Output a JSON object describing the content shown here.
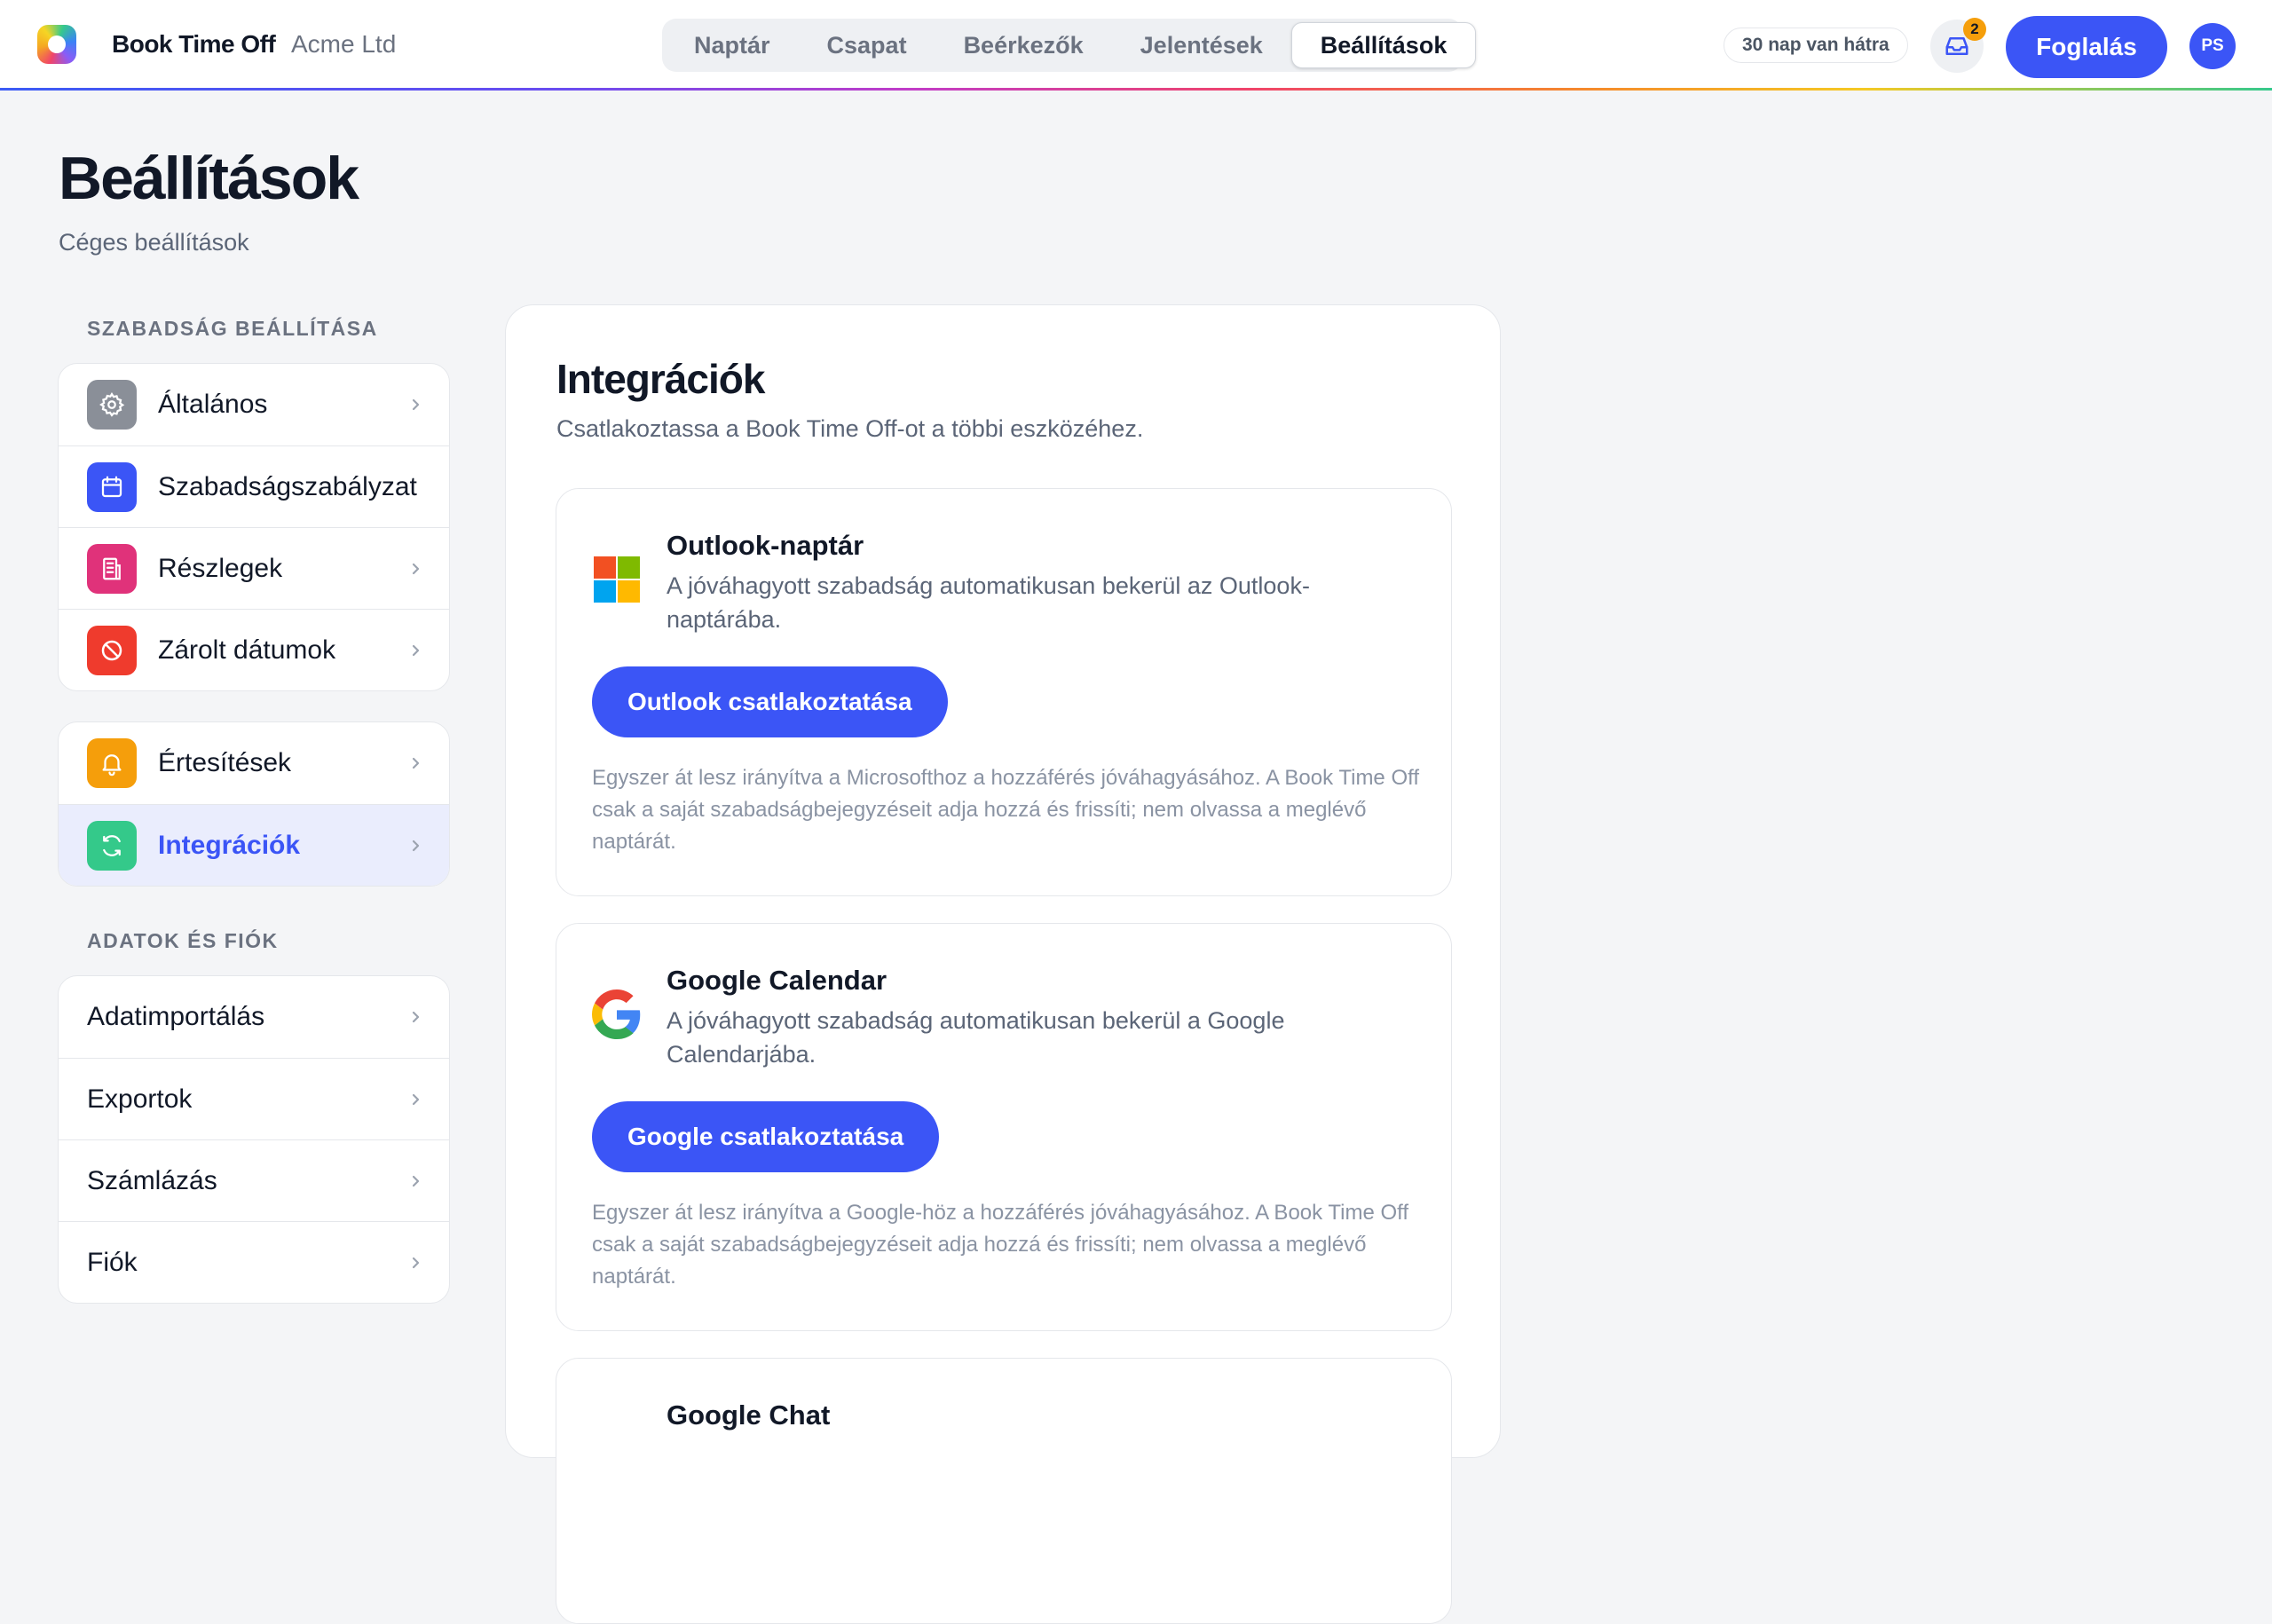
{
  "app": {
    "brand": "Book Time Off",
    "org": "Acme Ltd"
  },
  "nav": {
    "tabs": [
      {
        "label": "Naptár"
      },
      {
        "label": "Csapat"
      },
      {
        "label": "Beérkezők"
      },
      {
        "label": "Jelentések"
      },
      {
        "label": "Beállítások",
        "active": true
      }
    ]
  },
  "header": {
    "days_left": "30 nap van hátra",
    "inbox_count": "2",
    "book_label": "Foglalás",
    "avatar_initials": "PS"
  },
  "page": {
    "title": "Beállítások",
    "subtitle": "Céges beállítások"
  },
  "sidebar": {
    "section1_label": "SZABADSÁG BEÁLLÍTÁSA",
    "group1": [
      {
        "label": "Általános",
        "icon": "gear-icon",
        "color": "#8a8f98"
      },
      {
        "label": "Szabadságszabályzat",
        "icon": "calendar-icon",
        "color": "#3b55f6"
      },
      {
        "label": "Részlegek",
        "icon": "building-icon",
        "color": "#e0327a"
      },
      {
        "label": "Zárolt dátumok",
        "icon": "block-icon",
        "color": "#ef3b2d"
      }
    ],
    "group2": [
      {
        "label": "Értesítések",
        "icon": "bell-icon",
        "color": "#f59e0b"
      },
      {
        "label": "Integrációk",
        "icon": "sync-icon",
        "color": "#34c98a",
        "active": true
      }
    ],
    "section2_label": "ADATOK ÉS FIÓK",
    "group3": [
      {
        "label": "Adatimportálás"
      },
      {
        "label": "Exportok"
      },
      {
        "label": "Számlázás"
      },
      {
        "label": "Fiók"
      }
    ]
  },
  "main": {
    "title": "Integrációk",
    "subtitle": "Csatlakoztassa a Book Time Off-ot a többi eszközéhez.",
    "integrations": [
      {
        "name": "Outlook-naptár",
        "icon": "microsoft-icon",
        "description": "A jóváhagyott szabadság automatikusan bekerül az Outlook-naptárába.",
        "button": "Outlook csatlakoztatása",
        "note": "Egyszer át lesz irányítva a Microsofthoz a hozzáférés jóváhagyásához. A Book Time Off csak a saját szabadságbejegyzéseit adja hozzá és frissíti; nem olvassa a meglévő naptárát."
      },
      {
        "name": "Google Calendar",
        "icon": "google-icon",
        "description": "A jóváhagyott szabadság automatikusan bekerül a Google Calendarjába.",
        "button": "Google csatlakoztatása",
        "note": "Egyszer át lesz irányítva a Google-höz a hozzáférés jóváhagyásához. A Book Time Off csak a saját szabadságbejegyzéseit adja hozzá és frissíti; nem olvassa a meglévő naptárát."
      },
      {
        "name": "Google Chat",
        "icon": "google-chat-icon"
      }
    ]
  },
  "colors": {
    "accent": "#3b55f6",
    "page_bg": "#f4f5f7"
  }
}
